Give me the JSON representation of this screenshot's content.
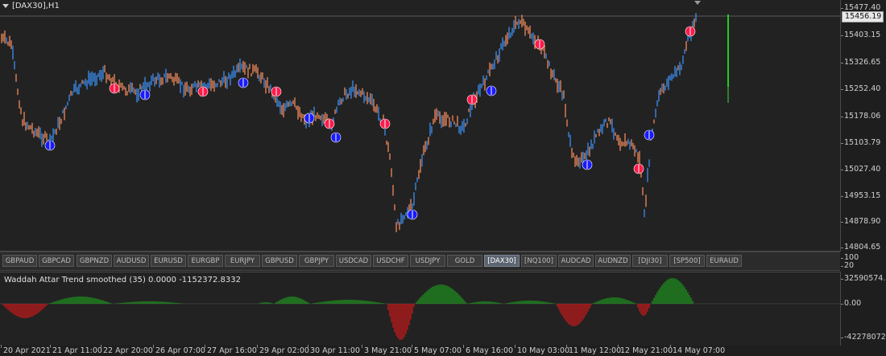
{
  "chart_title": "[DAX30],H1",
  "current_price": "15456.19",
  "price_axis_labels": [
    "15477.40",
    "15403.15",
    "15326.65",
    "15252.40",
    "15178.06",
    "15103.79",
    "15027.40",
    "14953.15",
    "14878.90",
    "14804.65"
  ],
  "symbol_axis_labels": [
    "100",
    "20"
  ],
  "symbols": [
    "GBPAUD",
    "GBPCAD",
    "GBPNZD",
    "AUDUSD",
    "EURUSD",
    "EURGBP",
    "EURJPY",
    "GBPUSD",
    "GBPJPY",
    "USDCAD",
    "USDCHF",
    "USDJPY",
    "GOLD",
    "[DAX30]",
    "[NQ100]",
    "AUDCAD",
    "AUDNZD",
    "[DJI30]",
    "[SP500]",
    "EURAUD"
  ],
  "active_symbol": "[DAX30]",
  "indicator": {
    "title": "Waddah Attar Trend smoothed",
    "params": "(35) 0.0000 -1152372.8332",
    "axis_labels": [
      "32590574.8",
      "0.00",
      "-42278072"
    ]
  },
  "time_labels": [
    "20 Apr 2021",
    "21 Apr 11:00",
    "22 Apr 20:00",
    "26 Apr 07:00",
    "27 Apr 16:00",
    "29 Apr 02:00",
    "30 Apr 11:00",
    "3 May 21:00",
    "5 May 07:00",
    "6 May 16:00",
    "10 May 03:00",
    "11 May 12:00",
    "12 May 21:00",
    "14 May 07:00"
  ],
  "colors": {
    "bull": "#3b8ff0",
    "bear": "#f08a5a",
    "up_marker": "#1a1aff",
    "down_marker": "#ff1a4a",
    "hist_up": "#1ea01e",
    "hist_down": "#d81818",
    "level_line": "#22cc22"
  }
}
